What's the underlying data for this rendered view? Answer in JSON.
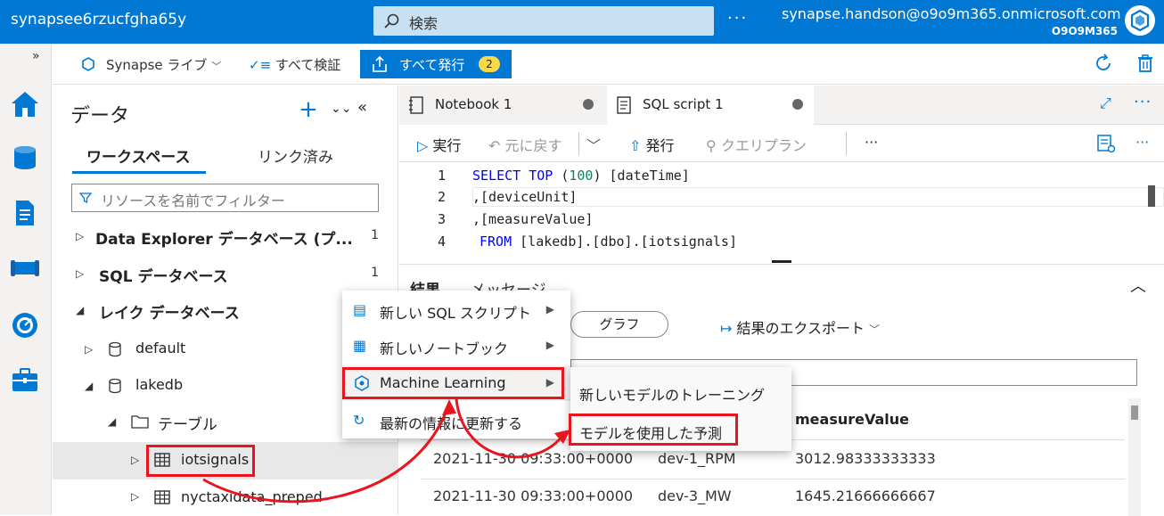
{
  "topbar": {
    "workspace_name": "synapsee6rzucfgha65y",
    "search_placeholder": "検索",
    "more": "···",
    "user_email": "synapse.handson@o9o9m365.onmicrosoft.com",
    "user_org": "O9O9M365"
  },
  "rail": {
    "expand": "»"
  },
  "toolbar": {
    "synapse_live": "Synapse ライブ",
    "validate_all": "すべて検証",
    "publish_all": "すべて発行",
    "publish_count": "2"
  },
  "data_panel": {
    "title": "データ",
    "add": "+",
    "tabs": {
      "workspace": "ワークスペース",
      "linked": "リンク済み"
    },
    "filter_placeholder": "リソースを名前でフィルター",
    "tree": [
      {
        "label": "Data Explorer データベース (プ...",
        "count": "1"
      },
      {
        "label": "SQL データベース",
        "count": "1"
      },
      {
        "label": "レイク データベース"
      },
      {
        "label": "default"
      },
      {
        "label": "lakedb"
      },
      {
        "label": "テーブル"
      },
      {
        "label": "iotsignals"
      },
      {
        "label": "nyctaxidata_preped"
      }
    ]
  },
  "editor": {
    "tabs": [
      {
        "label": "Notebook 1"
      },
      {
        "label": "SQL script 1"
      }
    ],
    "more": "···",
    "sql_toolbar": {
      "run": "実行",
      "undo": "元に戻す",
      "publish": "発行",
      "query_plan": "クエリプラン",
      "more": "···"
    },
    "line_numbers": [
      "1",
      "2",
      "3",
      "4"
    ],
    "code": {
      "l1_kw1": "SELECT",
      "l1_kw2": "TOP",
      "l1_open": " (",
      "l1_num": "100",
      "l1_rest": ") [dateTime]",
      "l2": ",[deviceUnit]",
      "l3": ",[measureValue]",
      "l4_kw": "FROM",
      "l4_rest": " [lakedb].[dbo].[iotsignals]"
    }
  },
  "results": {
    "tab_results": "結果",
    "tab_messages": "メッセージ",
    "graph": "グラフ",
    "export": "結果のエクスポート",
    "col3_header": "measureValue",
    "rows": [
      {
        "dateTime": "2021-11-30 09:33:00+0000",
        "deviceUnit": "dev-1_RPM",
        "measureValue": "3012.98333333333"
      },
      {
        "dateTime": "2021-11-30 09:33:00+0000",
        "deviceUnit": "dev-3_MW",
        "measureValue": "1645.21666666667"
      }
    ]
  },
  "context_menu": {
    "items": [
      {
        "label": "新しい SQL スクリプト"
      },
      {
        "label": "新しいノートブック"
      },
      {
        "label": "Machine Learning"
      },
      {
        "label": "最新の情報に更新する"
      }
    ],
    "submenu": [
      {
        "label": "新しいモデルのトレーニング"
      },
      {
        "label": "モデルを使用した予測"
      }
    ]
  },
  "colors": {
    "accent": "#0078d4",
    "highlight": "#e8141e",
    "badge": "#f9d949"
  }
}
